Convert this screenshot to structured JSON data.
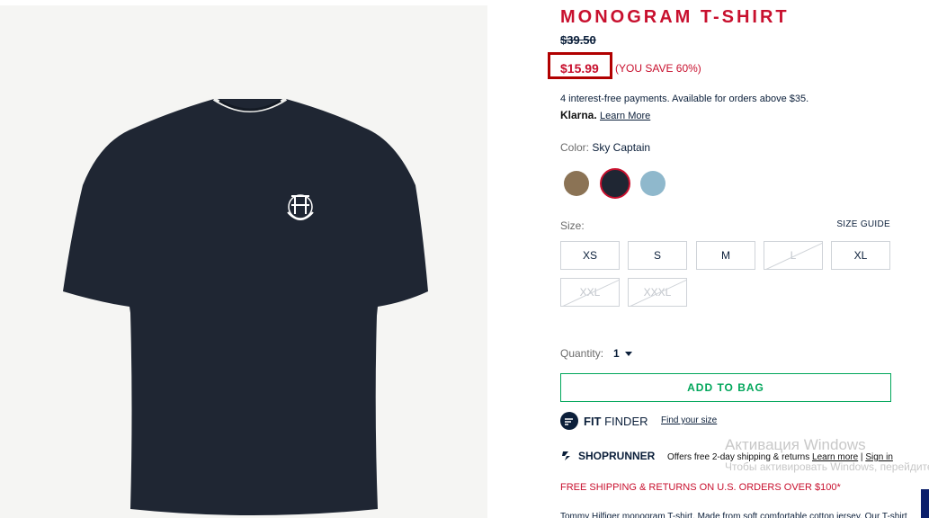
{
  "product": {
    "title": "MONOGRAM T-SHIRT",
    "original_price": "$39.50",
    "sale_price": "$15.99",
    "savings": "(YOU SAVE 60%)",
    "installments": "4 interest-free payments. Available for orders above $35.",
    "klarna_logo": "Klarna.",
    "klarna_link": "Learn More",
    "color_label": "Color: ",
    "color_value": "Sky Captain",
    "swatches": [
      {
        "name": "khaki",
        "color": "#8b7355",
        "selected": false
      },
      {
        "name": "sky-captain",
        "color": "#1f2633",
        "selected": true
      },
      {
        "name": "light-blue",
        "color": "#8fb8cc",
        "selected": false
      }
    ],
    "size_label": "Size:",
    "size_guide": "SIZE GUIDE",
    "sizes": [
      {
        "label": "XS",
        "available": true
      },
      {
        "label": "S",
        "available": true
      },
      {
        "label": "M",
        "available": true
      },
      {
        "label": "L",
        "available": false
      },
      {
        "label": "XL",
        "available": true
      },
      {
        "label": "XXL",
        "available": false
      },
      {
        "label": "XXXL",
        "available": false
      }
    ],
    "quantity_label": "Quantity:",
    "quantity_value": "1",
    "add_to_bag": "ADD TO BAG",
    "fit_finder_bold": "FIT",
    "fit_finder_text": " FINDER",
    "fit_link": "Find your size",
    "shoprunner_label": "SHOPRUNNER",
    "shoprunner_desc": "Offers free 2-day shipping & returns",
    "shoprunner_learn": "Learn more",
    "shoprunner_sep": " | ",
    "shoprunner_signin": "Sign in",
    "free_shipping": "FREE SHIPPING & RETURNS ON U.S. ORDERS OVER $100*",
    "description_snippet": "Tommy Hilfiger monogram T-shirt. Made from soft comfortable cotton jersey. Our T-shirt"
  },
  "windows_watermark": {
    "title": "Активация Windows",
    "subtitle": "Чтобы активировать Windows, перейдите в раздел \"Параметры\"."
  },
  "colors": {
    "brand_red": "#c8102e",
    "navy": "#0b1f3a",
    "green": "#00a65a",
    "shirt": "#1f2633"
  }
}
